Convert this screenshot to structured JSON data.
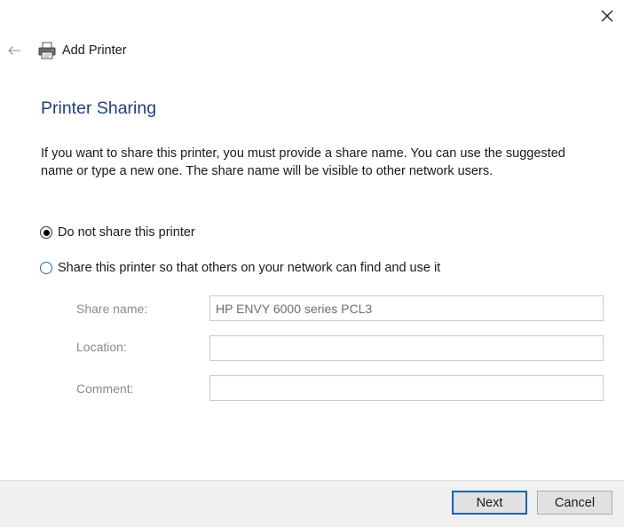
{
  "window": {
    "title": "Add Printer",
    "close_icon": "close-icon",
    "back_icon": "back-arrow-icon",
    "app_icon": "printer-icon"
  },
  "page": {
    "heading": "Printer Sharing",
    "description": "If you want to share this printer, you must provide a share name. You can use the suggested name or type a new one. The share name will be visible to other network users."
  },
  "options": [
    {
      "label": "Do not share this printer",
      "selected": true
    },
    {
      "label": "Share this printer so that others on your network can find and use it",
      "selected": false
    }
  ],
  "fields": {
    "share_name": {
      "label": "Share name:",
      "value": "HP ENVY 6000 series PCL3",
      "enabled": false
    },
    "location": {
      "label": "Location:",
      "value": "",
      "enabled": false
    },
    "comment": {
      "label": "Comment:",
      "value": "",
      "enabled": false
    }
  },
  "footer": {
    "next_label": "Next",
    "cancel_label": "Cancel"
  },
  "colors": {
    "heading": "#1f3f8c",
    "primary_button_border": "#0a64c8",
    "footer_bg": "#f0f0f0"
  }
}
